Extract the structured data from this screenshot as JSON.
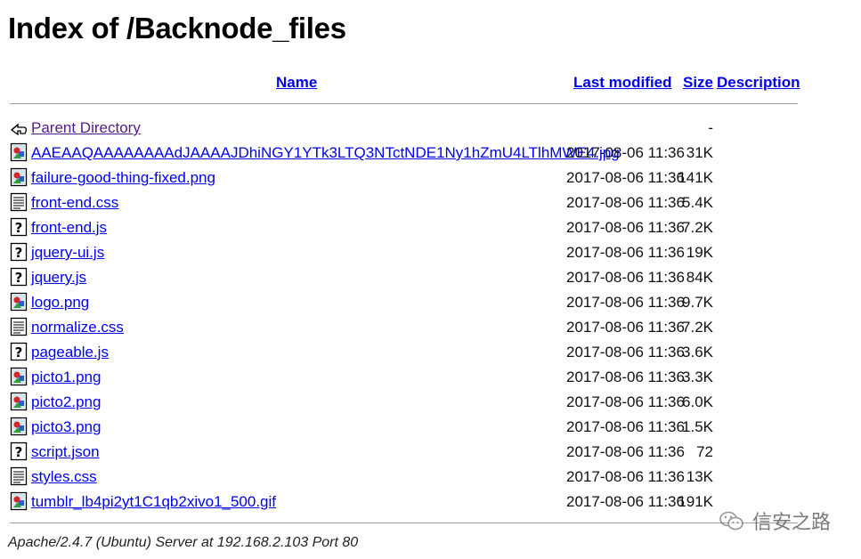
{
  "page_title": "Index of /Backnode_files",
  "columns": {
    "name": "Name",
    "last_modified": "Last modified",
    "size": "Size",
    "description": "Description"
  },
  "entries": [
    {
      "icon": "back-icon",
      "name": "Parent Directory",
      "date": "",
      "size": "-"
    },
    {
      "icon": "image-file-icon",
      "name": "AAEAAQAAAAAAAAdJAAAAJDhiNGY1YTk3LTQ3NTctNDE1Ny1hZmU4LTlhMWE4.jpg",
      "date": "2017-08-06 11:36",
      "size": "31K"
    },
    {
      "icon": "image-file-icon",
      "name": "failure-good-thing-fixed.png",
      "date": "2017-08-06 11:36",
      "size": "141K"
    },
    {
      "icon": "text-file-icon",
      "name": "front-end.css",
      "date": "2017-08-06 11:36",
      "size": "5.4K"
    },
    {
      "icon": "unknown-file-icon",
      "name": "front-end.js",
      "date": "2017-08-06 11:36",
      "size": "7.2K"
    },
    {
      "icon": "unknown-file-icon",
      "name": "jquery-ui.js",
      "date": "2017-08-06 11:36",
      "size": "19K"
    },
    {
      "icon": "unknown-file-icon",
      "name": "jquery.js",
      "date": "2017-08-06 11:36",
      "size": "84K"
    },
    {
      "icon": "image-file-icon",
      "name": "logo.png",
      "date": "2017-08-06 11:36",
      "size": "9.7K"
    },
    {
      "icon": "text-file-icon",
      "name": "normalize.css",
      "date": "2017-08-06 11:36",
      "size": "7.2K"
    },
    {
      "icon": "unknown-file-icon",
      "name": "pageable.js",
      "date": "2017-08-06 11:36",
      "size": "3.6K"
    },
    {
      "icon": "image-file-icon",
      "name": "picto1.png",
      "date": "2017-08-06 11:36",
      "size": "3.3K"
    },
    {
      "icon": "image-file-icon",
      "name": "picto2.png",
      "date": "2017-08-06 11:36",
      "size": "6.0K"
    },
    {
      "icon": "image-file-icon",
      "name": "picto3.png",
      "date": "2017-08-06 11:36",
      "size": "1.5K"
    },
    {
      "icon": "unknown-file-icon",
      "name": "script.json",
      "date": "2017-08-06 11:36",
      "size": "72"
    },
    {
      "icon": "text-file-icon",
      "name": "styles.css",
      "date": "2017-08-06 11:36",
      "size": "13K"
    },
    {
      "icon": "image-file-icon",
      "name": "tumblr_lb4pi2yt1C1qb2xivo1_500.gif",
      "date": "2017-08-06 11:36",
      "size": "191K"
    }
  ],
  "footer": "Apache/2.4.7 (Ubuntu) Server at 192.168.2.103 Port 80",
  "watermark": "信安之路",
  "colors": {
    "link": "#0000EE",
    "visited_link": "#551A8B",
    "rule": "#a0a0a0"
  }
}
